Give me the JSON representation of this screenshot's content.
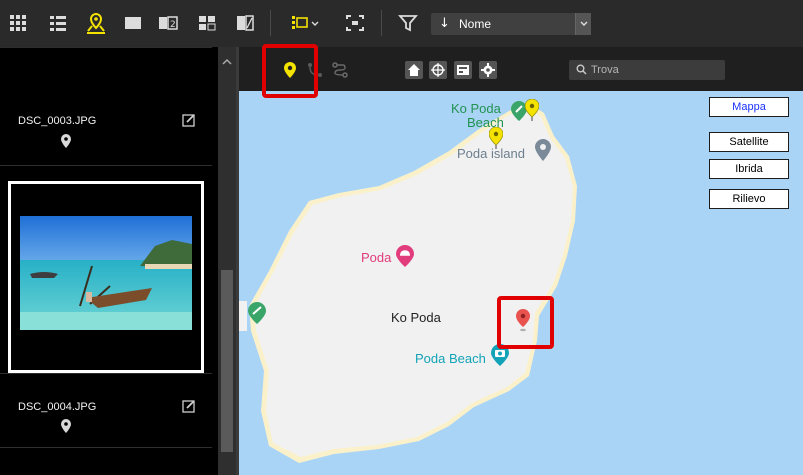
{
  "toolbar": {
    "icons": [
      "grid-view-icon",
      "list-view-icon",
      "map-view-icon",
      "full-screen-view-icon",
      "compare-view-icon",
      "filmstrip-view-icon",
      "image-viewer-icon",
      "layout-toggle-icon",
      "fit-icon",
      "filter-icon"
    ],
    "sort": {
      "selected": "Nome",
      "glyph": "↓"
    }
  },
  "filmstrip": {
    "items": [
      {
        "name": "DSC_0003.JPG",
        "has_location": true
      },
      {
        "name": "DSC_0004.JPG",
        "has_location": true
      }
    ],
    "selected_index": 0
  },
  "map_toolbar": {
    "search_placeholder": "Trova",
    "icons": [
      "location-pin-icon",
      "track-icon",
      "route-icon",
      "home-icon",
      "crosshair-icon",
      "map-info-icon",
      "settings-icon"
    ]
  },
  "map": {
    "types": [
      {
        "label": "Mappa",
        "active": true
      },
      {
        "label": "Satellite",
        "active": false
      },
      {
        "label": "Ibrida",
        "active": false
      },
      {
        "label": "Rilievo",
        "active": false
      }
    ],
    "labels": {
      "beach_north_1": "Ko Poda",
      "beach_north_2": "Beach",
      "island": "Poda island",
      "poda": "Poda",
      "ko_poda": "Ko Poda",
      "poda_beach": "Poda Beach"
    },
    "colors": {
      "water": "#a9d4f6",
      "land": "#f1f1f1",
      "beach": "#faf1cb",
      "park": "#3aa569",
      "poi_pink": "#e13c7c",
      "poi_teal": "#13a3b8",
      "poi_grey": "#7a8a99",
      "photo_pin": "#e8534f",
      "active_map_type": "#1a33ff"
    }
  },
  "highlight_color": "#e00000"
}
